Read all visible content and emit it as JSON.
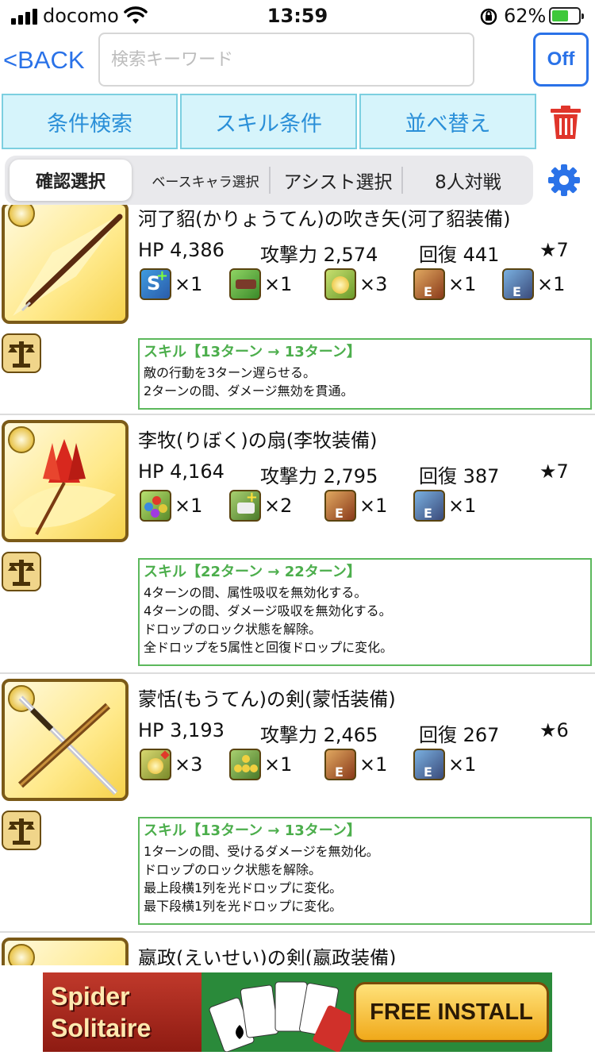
{
  "status_bar": {
    "carrier": "docomo",
    "time": "13:59",
    "battery": "62%",
    "battery_level": 0.62
  },
  "header": {
    "back_label": "<BACK",
    "search_placeholder": "検索キーワード",
    "toggle_label": "Off"
  },
  "filters": [
    {
      "label": "条件検索"
    },
    {
      "label": "スキル条件"
    },
    {
      "label": "並べ替え"
    }
  ],
  "segments": [
    {
      "label": "確認選択",
      "active": true
    },
    {
      "label": "ベースキャラ選択"
    },
    {
      "label": "アシスト選択"
    },
    {
      "label": "8人対戦"
    }
  ],
  "items": [
    {
      "name": "河了貂(かりょうてん)の吹き矢(河了貂装備)",
      "hp": "HP 4,386",
      "atk": "攻撃力 2,574",
      "rcv": "回復 441",
      "rarity": "★7",
      "awakenings": [
        {
          "icon": "skill-boost-icon",
          "count": "×1"
        },
        {
          "icon": "bind-resist-icon",
          "count": "×1"
        },
        {
          "icon": "light-orb-enhance-icon",
          "count": "×3"
        },
        {
          "icon": "equip-balance-killer-icon",
          "count": "×1"
        },
        {
          "icon": "equip-machine-killer-icon",
          "count": "×1"
        }
      ],
      "skill_title": "スキル【13ターン → 13ターン】",
      "skill_lines": [
        "敵の行動を3ターン遅らせる。",
        "2ターンの間、ダメージ無効を貫通。"
      ]
    },
    {
      "name": "李牧(りぼく)の扇(李牧装備)",
      "hp": "HP 4,164",
      "atk": "攻撃力 2,795",
      "rcv": "回復 387",
      "rarity": "★7",
      "awakenings": [
        {
          "icon": "multi-color-orb-icon",
          "count": "×1"
        },
        {
          "icon": "bind-recovery-icon",
          "count": "×2"
        },
        {
          "icon": "equip-balance-killer-icon",
          "count": "×1"
        },
        {
          "icon": "equip-machine-killer-icon",
          "count": "×1"
        }
      ],
      "skill_title": "スキル【22ターン → 22ターン】",
      "skill_lines": [
        "4ターンの間、属性吸収を無効化する。",
        "4ターンの間、ダメージ吸収を無効化する。",
        "ドロップのロック状態を解除。",
        "全ドロップを5属性と回復ドロップに変化。"
      ]
    },
    {
      "name": "蒙恬(もうてん)の剣(蒙恬装備)",
      "hp": "HP 3,193",
      "atk": "攻撃力 2,465",
      "rcv": "回復 267",
      "rarity": "★6",
      "awakenings": [
        {
          "icon": "light-row-enhance-icon",
          "count": "×3"
        },
        {
          "icon": "light-orb-plus-icon",
          "count": "×1"
        },
        {
          "icon": "equip-balance-killer-icon",
          "count": "×1"
        },
        {
          "icon": "equip-machine-killer-icon",
          "count": "×1"
        }
      ],
      "skill_title": "スキル【13ターン → 13ターン】",
      "skill_lines": [
        "1ターンの間、受けるダメージを無効化。",
        "ドロップのロック状態を解除。",
        "最上段横1列を光ドロップに変化。",
        "最下段横1列を光ドロップに変化。"
      ]
    },
    {
      "name": "嬴政(えいせい)の剣(嬴政装備)"
    }
  ],
  "ad": {
    "title_line1": "Spider",
    "title_line2": "Solitaire",
    "cta": "FREE INSTALL"
  },
  "colors": {
    "accent": "#2a72e8",
    "filter_bg": "#d6f4fb",
    "filter_text": "#2a8fd8",
    "skill_green": "#4cae4c",
    "trash_red": "#e0352b"
  }
}
